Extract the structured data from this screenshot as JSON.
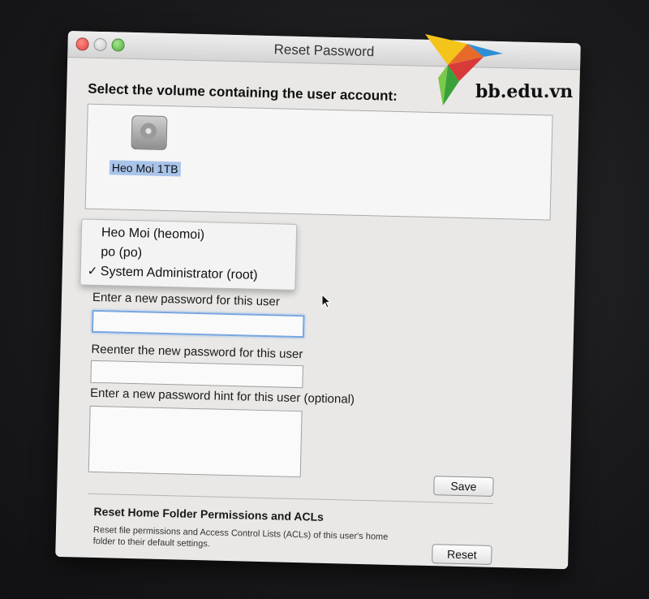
{
  "window": {
    "title": "Reset Password"
  },
  "volume_section": {
    "heading": "Select the volume containing the user account:",
    "volume_name": "Heo Moi 1TB"
  },
  "user_menu": {
    "items": [
      {
        "label": "Heo Moi (heomoi)",
        "checked": false
      },
      {
        "label": "po (po)",
        "checked": false
      },
      {
        "label": "System Administrator (root)",
        "checked": true
      }
    ],
    "check_glyph": "✓"
  },
  "password_form": {
    "new_password_label": "Enter a new password for this user",
    "new_password_value": "",
    "reenter_label": "Reenter the new password for this user",
    "reenter_value": "",
    "hint_label": "Enter a new password hint for this user (optional)",
    "hint_value": "",
    "save_label": "Save"
  },
  "permissions_section": {
    "title": "Reset Home Folder Permissions and ACLs",
    "description": "Reset file permissions and Access Control Lists (ACLs) of this user's home folder to their default settings.",
    "reset_label": "Reset"
  },
  "watermark": {
    "text": "bb.edu.vn"
  },
  "colors": {
    "selection": "#a9c4ea",
    "focus_ring": "#7aa6e0",
    "window_bg": "#e9e8e6"
  }
}
